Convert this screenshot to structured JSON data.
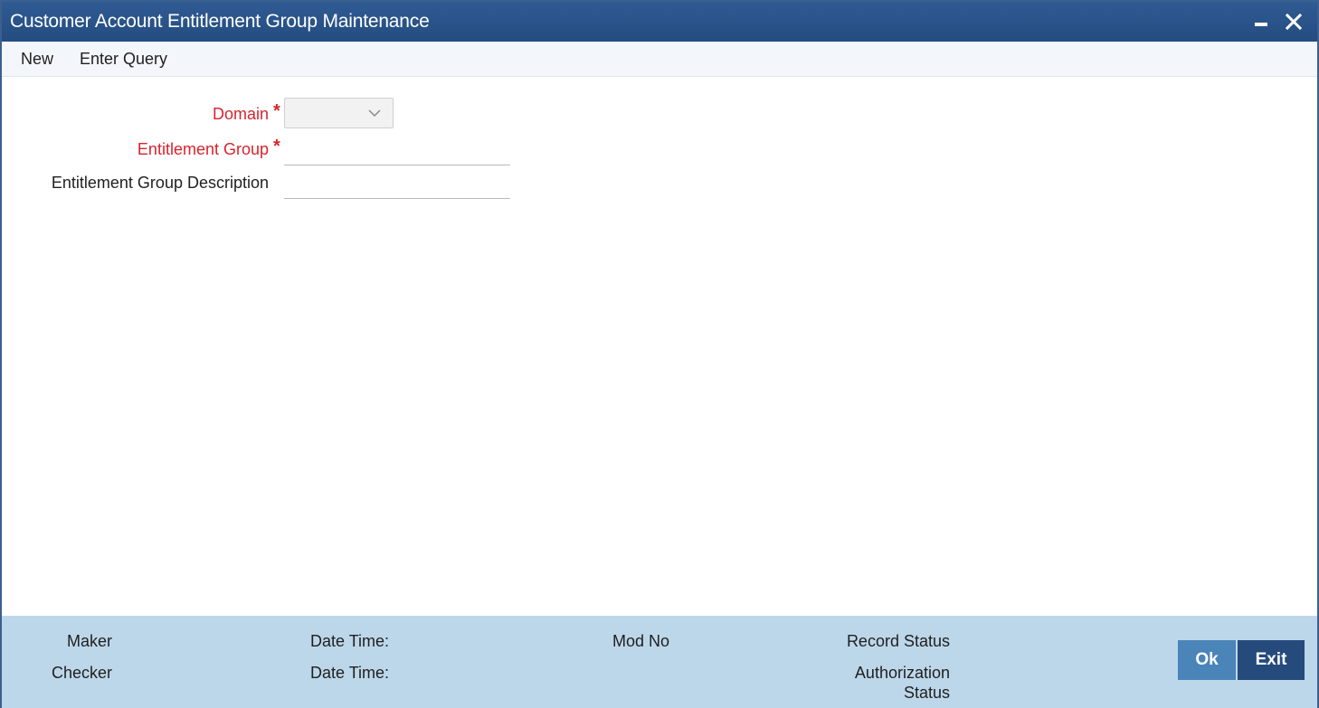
{
  "window": {
    "title": "Customer Account Entitlement Group Maintenance",
    "controls": {
      "minimize_icon": "minimize-icon",
      "close_icon": "close-icon"
    }
  },
  "menu": {
    "new_label": "New",
    "enter_query_label": "Enter Query"
  },
  "form": {
    "domain": {
      "label": "Domain",
      "required_mark": "*",
      "value": "",
      "icon": "chevron-down-icon"
    },
    "entitlement_group": {
      "label": "Entitlement Group",
      "required_mark": "*",
      "value": ""
    },
    "entitlement_group_description": {
      "label": "Entitlement Group Description",
      "value": ""
    }
  },
  "footer": {
    "maker_label": "Maker",
    "checker_label": "Checker",
    "maker_date_time_label": "Date Time:",
    "checker_date_time_label": "Date Time:",
    "mod_no_label": "Mod No",
    "record_status_label": "Record Status",
    "authorization_status_line1": "Authorization",
    "authorization_status_line2": "Status",
    "ok_label": "Ok",
    "exit_label": "Exit"
  },
  "colors": {
    "titlebar": "#2a548a",
    "required_label": "#d9232e",
    "footer_bg": "#bdd7ea",
    "ok_button": "#4a84b8",
    "exit_button": "#254a7c"
  }
}
